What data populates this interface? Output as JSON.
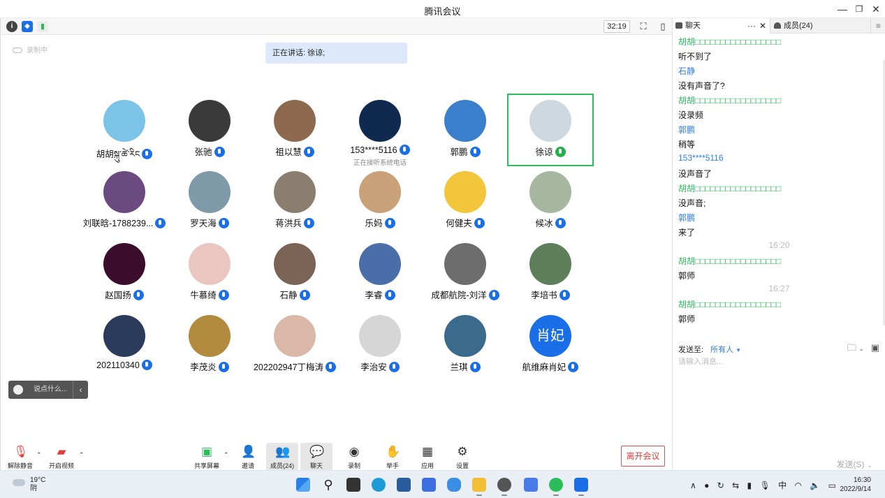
{
  "window": {
    "title": "腾讯会议"
  },
  "topbar": {
    "timer": "32:19"
  },
  "recording": {
    "label": "录制中"
  },
  "speaking": {
    "text": "正在讲话: 徐谅;"
  },
  "participants": [
    {
      "name": "胡胡སྐུ་ཚེ་རིང",
      "avatar_color": "#7cc3e8",
      "mic": "on"
    },
    {
      "name": "张驰",
      "avatar_color": "#3a3a3a",
      "mic": "on"
    },
    {
      "name": "祖以慧",
      "avatar_color": "#8d6a4f",
      "mic": "on"
    },
    {
      "name": "153****5116",
      "sub": "正在接听系统电话",
      "avatar_color": "#0f2a4e",
      "mic": "on"
    },
    {
      "name": "郭鹏",
      "avatar_color": "#3a7fcc",
      "mic": "on"
    },
    {
      "name": "徐谅",
      "avatar_color": "#cfd8df",
      "mic": "active"
    },
    {
      "name": "刘联晗-1788239...",
      "avatar_color": "#6b4b7f",
      "mic": "on"
    },
    {
      "name": "罗天海",
      "avatar_color": "#7f9aa8",
      "mic": "on"
    },
    {
      "name": "蒋洪兵",
      "avatar_color": "#8a7f6e",
      "mic": "on"
    },
    {
      "name": "乐妈",
      "avatar_color": "#c9a27a",
      "mic": "on"
    },
    {
      "name": "何健夫",
      "avatar_color": "#f2c53a",
      "mic": "on"
    },
    {
      "name": "候冰",
      "avatar_color": "#a7b7a0",
      "mic": "on"
    },
    {
      "name": "赵国扬",
      "avatar_color": "#3b0e2d",
      "mic": "on"
    },
    {
      "name": "牛慕绮",
      "avatar_color": "#e9c7c0",
      "mic": "on"
    },
    {
      "name": "石静",
      "avatar_color": "#7b6355",
      "mic": "on"
    },
    {
      "name": "李睿",
      "avatar_color": "#4a6fa8",
      "mic": "on"
    },
    {
      "name": "成都航院-刘洋",
      "avatar_color": "#6d6d6d",
      "mic": "on"
    },
    {
      "name": "李培书",
      "avatar_color": "#5d7f5a",
      "mic": "on"
    },
    {
      "name": "202110340",
      "avatar_color": "#2b3b5c",
      "mic": "on"
    },
    {
      "name": "李茂炎",
      "avatar_color": "#b28b3e",
      "mic": "on"
    },
    {
      "name": "202202947丁梅涛",
      "avatar_color": "#d9b8a8",
      "mic": "on"
    },
    {
      "name": "李治安",
      "avatar_color": "#d6d6d6",
      "mic": "on"
    },
    {
      "name": "兰琪",
      "avatar_color": "#3a6a8c",
      "mic": "on"
    },
    {
      "name": "航维麻肖妃",
      "avatar_text": "肖妃",
      "avatar_color": "#1a6fe8",
      "mic": "on"
    }
  ],
  "chat_input": {
    "placeholder": "说点什么..."
  },
  "toolbar": {
    "unmute": "解除静音",
    "video": "开启视频",
    "share": "共享屏幕",
    "invite": "邀请",
    "members": "成员(24)",
    "chat": "聊天",
    "record": "录制",
    "raise_hand": "举手",
    "apps": "应用",
    "settings": "设置",
    "leave": "离开会议"
  },
  "panel": {
    "tab_chat": "聊天",
    "tab_members": "成员(24)",
    "more": "···",
    "messages": [
      {
        "sender": "胡胡□□□□□□□□□□□□□□□□□",
        "text": "听不到了",
        "color": "green"
      },
      {
        "sender": "石静",
        "text": "没有声音了?",
        "color": "blue"
      },
      {
        "sender": "胡胡□□□□□□□□□□□□□□□□□",
        "text": "没录频",
        "color": "green"
      },
      {
        "sender": "郭鹏",
        "text": "稍等",
        "color": "blue"
      },
      {
        "sender": "153****5116",
        "text": "没声音了",
        "color": "blue"
      },
      {
        "sender": "胡胡□□□□□□□□□□□□□□□□□",
        "text": "没声音;",
        "color": "green"
      },
      {
        "sender": "郭鹏",
        "text": "来了",
        "color": "blue"
      },
      {
        "time": "16:20"
      },
      {
        "sender": "胡胡□□□□□□□□□□□□□□□□□",
        "text": "郭师",
        "color": "green"
      },
      {
        "time": "16:27"
      },
      {
        "sender": "胡胡□□□□□□□□□□□□□□□□□",
        "text": "郭师",
        "color": "green"
      }
    ],
    "send_to_label": "发送至:",
    "send_to_value": "所有人",
    "input_placeholder": "请输入消息...",
    "send_button": "发送(S)"
  },
  "taskbar": {
    "temp": "19°C",
    "weather": "阴",
    "ime": "中",
    "time": "16:30",
    "date": "2022/9/14"
  }
}
